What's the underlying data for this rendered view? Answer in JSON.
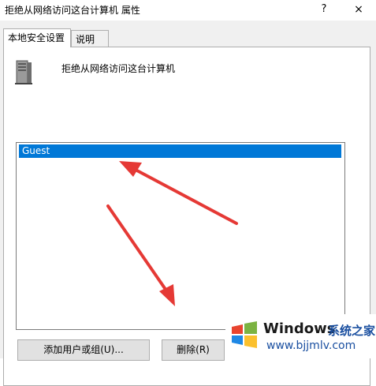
{
  "window": {
    "title": "拒绝从网络访问这台计算机 属性",
    "help_glyph": "?",
    "close_glyph": "×"
  },
  "tabs": [
    {
      "label": "本地安全设置",
      "active": true
    },
    {
      "label": "说明",
      "active": false
    }
  ],
  "policy": {
    "icon": "server-computer-icon",
    "name": "拒绝从网络访问这台计算机"
  },
  "members": {
    "items": [
      {
        "label": "Guest",
        "selected": true
      }
    ]
  },
  "buttons": {
    "add": "添加用户或组(U)...",
    "remove": "删除(R)"
  },
  "watermark": {
    "logo": "windows-logo-icon",
    "brand": "Windows",
    "brand2": "系统之家",
    "url": "www.bjjmlv.com"
  },
  "colors": {
    "selection": "#0078d7",
    "arrow": "#e53935",
    "dialog_bg": "#f0f0f0"
  }
}
